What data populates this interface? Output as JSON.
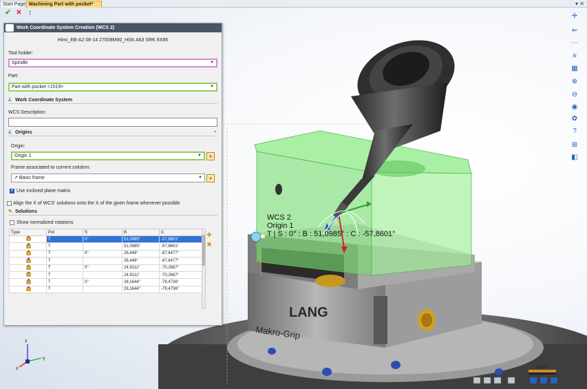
{
  "tabs": [
    {
      "label": "Start Page",
      "active": false
    },
    {
      "label": "Machining Part with pocket*",
      "active": true
    }
  ],
  "quick_access": {
    "confirm_icon": "check-icon",
    "cancel_icon": "close-icon",
    "info_icon": "info-icon"
  },
  "viewport_overlay": {
    "wcs_name": "WCS 2",
    "origin_name": "Origin 1",
    "solution_readout": "T | S : 0° : B : 51,0985° : C : -57,8601°"
  },
  "scene_labels": {
    "vise_brand": "LANG",
    "vise_model": "Makro-Grip"
  },
  "scale_bar": "20mm",
  "dialog": {
    "title": "Work Coordinate System Creation (WCS 2)",
    "tool_name": "Hirni_EB-A2 08-14 27008M90_HSK A63 SRK 8X85",
    "tool_holder_label": "Tool holder:",
    "tool_holder_value": "Spindle",
    "part_label": "Part:",
    "part_value": "Part with pocket <1519>",
    "wcs_section": "Work Coordinate System",
    "wcs_description_label": "WCS Description:",
    "wcs_description_value": "",
    "origins_section": "Origins",
    "origin_label": "Origin:",
    "origin_value": "Origin 1",
    "frame_label": "Frame associated to current solution:",
    "frame_value": "Basic frame",
    "use_inclined_label": "Use inclined plane matrix",
    "use_inclined_checked": true,
    "align_label": "Align the X of WCS' solutions onto the X of the given frame whenever possible",
    "align_checked": false,
    "solutions_section": "Solutions",
    "show_normalized_label": "Show normalized rotations",
    "show_normalized_checked": false,
    "table": {
      "columns": [
        "Type",
        "Pot",
        "S",
        "B",
        "C"
      ],
      "rows": [
        {
          "pot": "T",
          "s": "0°",
          "b": "51,0985°",
          "c": "-57,8601°",
          "selected": true
        },
        {
          "pot": "T",
          "s": "",
          "b": "51,0985°",
          "c": "-57,8601°",
          "selected": false
        },
        {
          "pot": "T",
          "s": "0°",
          "b": "26,448°",
          "c": "-67,8477°",
          "selected": false
        },
        {
          "pot": "T",
          "s": "",
          "b": "26,448°",
          "c": "-67,8477°",
          "selected": false
        },
        {
          "pot": "T",
          "s": "0°",
          "b": "24,9111°",
          "c": "-70,2667°",
          "selected": false
        },
        {
          "pot": "T",
          "s": "",
          "b": "24,9111°",
          "c": "-70,2667°",
          "selected": false
        },
        {
          "pot": "T",
          "s": "0°",
          "b": "28,1644°",
          "c": "-79,4736°",
          "selected": false
        },
        {
          "pot": "T",
          "s": "",
          "b": "28,1644°",
          "c": "-79,4736°",
          "selected": false
        }
      ]
    }
  },
  "triad_labels": {
    "x": "x",
    "y": "y",
    "z": "z"
  },
  "colors": {
    "part_green": "#7fe07a",
    "selection_blue": "#2f73d6",
    "title_bar": "#4a5563",
    "active_tab": "#fcd97a"
  }
}
